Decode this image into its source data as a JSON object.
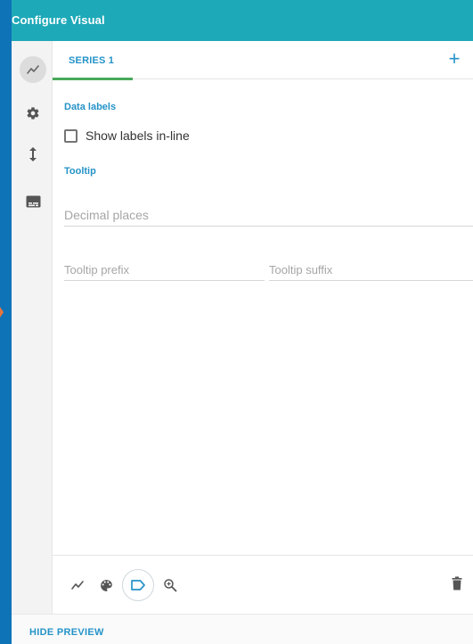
{
  "header": {
    "title": "Configure Visual"
  },
  "rail": {
    "items": [
      {
        "icon": "line-chart-icon",
        "active": true
      },
      {
        "icon": "gear-icon",
        "active": false
      },
      {
        "icon": "vertical-arrows-icon",
        "active": false
      },
      {
        "icon": "subtitles-icon",
        "active": false
      }
    ]
  },
  "tabs": {
    "series_label": "SERIES 1",
    "add_label": "+"
  },
  "data_labels": {
    "title": "Data labels",
    "show_inline_label": "Show labels in-line",
    "show_inline_checked": false
  },
  "tooltip": {
    "title": "Tooltip",
    "decimal_places_placeholder": "Decimal places",
    "prefix_placeholder": "Tooltip prefix",
    "suffix_placeholder": "Tooltip suffix"
  },
  "toolbar": {
    "items": [
      "line-chart-icon",
      "palette-icon",
      "label-icon",
      "zoom-in-icon"
    ],
    "active": "label-icon",
    "delete": "trash-icon"
  },
  "bottom": {
    "hide_preview_label": "HIDE PREVIEW"
  },
  "colors": {
    "page_bg": "#0f73b8",
    "header": "#1ea9b8",
    "accent": "#2593c8",
    "tab_ink": "#48a95a"
  }
}
